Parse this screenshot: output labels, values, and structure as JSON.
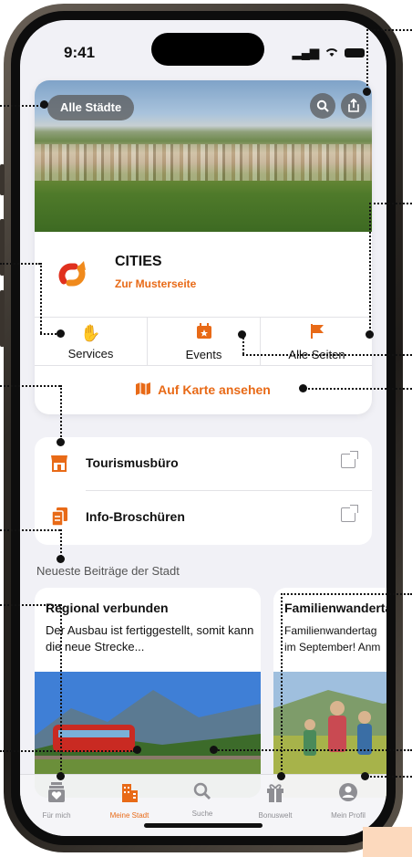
{
  "status": {
    "time": "9:41"
  },
  "city_card": {
    "all_cities_label": "Alle Städte",
    "city_name": "CITIES",
    "city_link": "Zur Musterseite",
    "actions": [
      {
        "label": "Services",
        "icon": "hand-gear-icon"
      },
      {
        "label": "Events",
        "icon": "calendar-star-icon"
      },
      {
        "label": "Alle Seiten",
        "icon": "flag-icon"
      }
    ],
    "map_label": "Auf Karte ansehen"
  },
  "links": [
    {
      "label": "Tourismusbüro",
      "icon": "store-icon"
    },
    {
      "label": "Info-Broschüren",
      "icon": "documents-icon"
    }
  ],
  "news_section_title": "Neueste Beiträge der Stadt",
  "news": [
    {
      "title": "Regional verbunden",
      "text": "Der Ausbau ist fertiggestellt, somit kann die neue Strecke..."
    },
    {
      "title": "Familienwandertag",
      "text": "Familienwandertag im September! Anm"
    }
  ],
  "tabbar": [
    {
      "label": "Für mich",
      "icon": "heart-box-icon",
      "active": false
    },
    {
      "label": "Meine Stadt",
      "icon": "buildings-icon",
      "active": true
    },
    {
      "label": "Suche",
      "icon": "search-icon",
      "active": false
    },
    {
      "label": "Bonuswelt",
      "icon": "gift-icon",
      "active": false
    },
    {
      "label": "Mein Profil",
      "icon": "profile-icon",
      "active": false
    }
  ],
  "colors": {
    "accent": "#e86a17",
    "background": "#f1f1f6"
  }
}
